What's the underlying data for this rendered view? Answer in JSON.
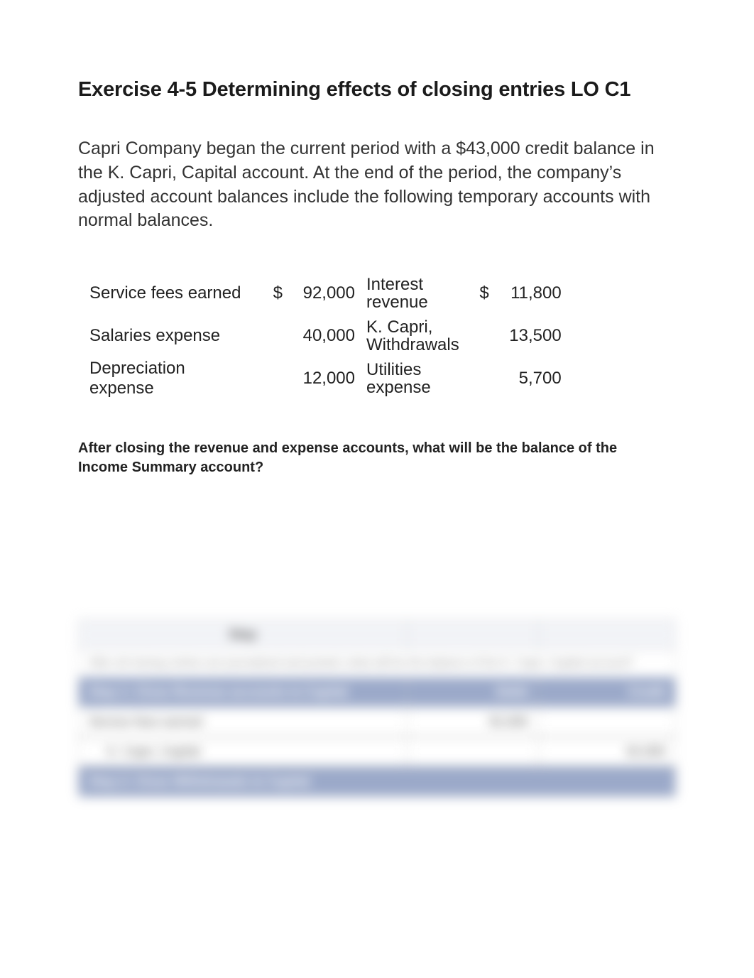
{
  "title": "Exercise 4-5 Determining effects of closing entries LO C1",
  "intro": "Capri Company began the current period with a $43,000 credit balance in the K. Capri, Capital account. At the end of the period, the company’s adjusted account balances include the following temporary accounts with normal balances.",
  "accounts": {
    "r1": {
      "l1": "Service fees earned",
      "c1": "$",
      "v1": "92,000",
      "l2": "Interest revenue",
      "c2": "$",
      "v2": "11,800"
    },
    "r2": {
      "l1": "Salaries expense",
      "c1": "",
      "v1": "40,000",
      "l2": "K. Capri, Withdrawals",
      "c2": "",
      "v2": "13,500"
    },
    "r3": {
      "l1": "Depreciation expense",
      "c1": "",
      "v1": "12,000",
      "l2": "Utilities expense",
      "c2": "",
      "v2": "5,700"
    }
  },
  "question": "After closing the revenue and expense accounts, what will be the balance of the Income Summary account?",
  "blurred": {
    "hdr_center": "Step",
    "col_debit": "Debit",
    "col_credit": "Credit",
    "note": "After all closing entries are journalized and posted, what will be the balance of the K. Capri, Capital account?",
    "sec1": "Step 1: Close Revenue accounts to Capital",
    "row1_label": "Service fees earned",
    "row1_val": "92,000",
    "row2_label": "K. Capri, Capital",
    "row2_val": "92,000",
    "sec2": "Step 2: Close Withdrawals to Capital"
  }
}
